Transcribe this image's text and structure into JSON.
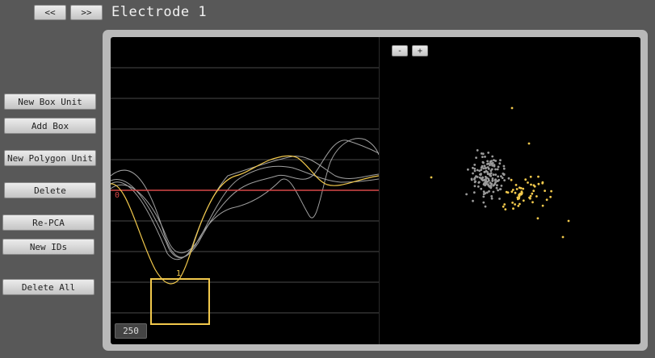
{
  "nav": {
    "prev_label": "<<",
    "next_label": ">>"
  },
  "window": {
    "title": "Electrode 1"
  },
  "sidebar": {
    "new_box_unit": "New Box Unit",
    "add_box": "Add Box",
    "new_polygon_unit": "New Polygon Unit",
    "delete": "Delete",
    "re_pca": "Re-PCA",
    "new_ids": "New IDs",
    "delete_all": "Delete All"
  },
  "waveform": {
    "time_button": "250",
    "unit_label": "1",
    "threshold_marker": "0",
    "colors": {
      "unit": "#f2c94c",
      "unsorted": "#bdbdbd",
      "threshold": "#d84848",
      "grid": "#4a4a4a"
    }
  },
  "scatter": {
    "zoom_out_label": "-",
    "zoom_in_label": "+",
    "colors": {
      "unit": "#f2c94c",
      "unsorted": "#9a9a9a"
    }
  }
}
